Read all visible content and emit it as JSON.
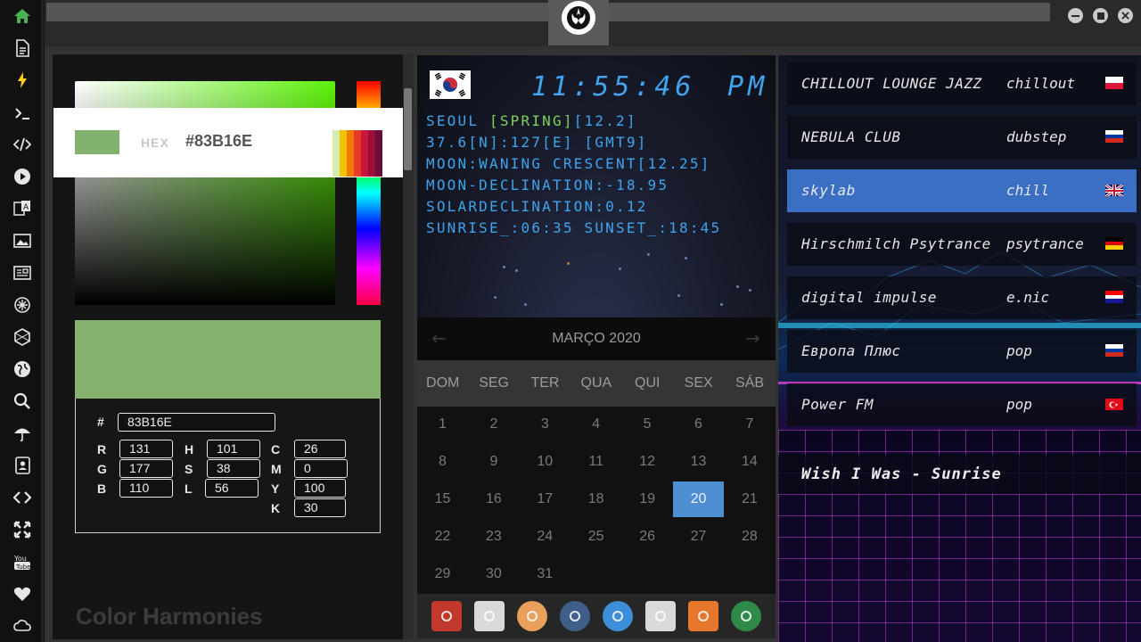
{
  "colors": {
    "selected": "#83B16E",
    "accent_blue": "#4E8FD4",
    "clock_blue": "#40A4F0",
    "station_active": "#3A6FC4"
  },
  "color_picker": {
    "hex_label": "HEX",
    "hex_value": "#83B16E",
    "hash_label": "#",
    "hex_input": "83B16E",
    "r_label": "R",
    "r_value": "131",
    "g_label": "G",
    "g_value": "177",
    "b_label": "B",
    "b_value": "110",
    "h_label": "H",
    "h_value": "101",
    "s_label": "S",
    "s_value": "38",
    "l_label": "L",
    "l_value": "56",
    "c_label": "C",
    "c_value": "26",
    "m_label": "M",
    "m_value": "0",
    "y_label": "Y",
    "y_value": "100",
    "k_label": "K",
    "k_value": "30",
    "harmonies_title": "Color Harmonies",
    "shade_colors": [
      "#d4ecaf",
      "#f2c200",
      "#f07a00",
      "#e63a2a",
      "#c8173a",
      "#9c0f3d",
      "#6b0c3a"
    ]
  },
  "clock": {
    "time": "11:55:46",
    "ampm": "PM",
    "city": "SEOUL ",
    "season": "[SPRING]",
    "season_value": "[12.2]",
    "coords": "37.6[N]:127[E] [GMT9]",
    "moon": "MOON:WANING CRESCENT[12.25]",
    "moon_declination": "MOON-DECLINATION:-18.95",
    "solar_declination": "SOLARDECLINATION:0.12",
    "sun": "SUNRISE_:06:35 SUNSET_:18:45"
  },
  "calendar": {
    "month_title": "MARÇO 2020",
    "prev": "←",
    "next": "→",
    "weekdays": [
      "DOM",
      "SEG",
      "TER",
      "QUA",
      "QUI",
      "SEX",
      "SÁB"
    ],
    "weeks": [
      [
        "1",
        "2",
        "3",
        "4",
        "5",
        "6",
        "7"
      ],
      [
        "8",
        "9",
        "10",
        "11",
        "12",
        "13",
        "14"
      ],
      [
        "15",
        "16",
        "17",
        "18",
        "19",
        "20",
        "21"
      ],
      [
        "22",
        "23",
        "24",
        "25",
        "26",
        "27",
        "28"
      ],
      [
        "29",
        "30",
        "31",
        "",
        "",
        "",
        ""
      ]
    ],
    "today": "20"
  },
  "dock": [
    {
      "icon": "app-launcher-icon",
      "color": "#c0392b"
    },
    {
      "icon": "news-icon",
      "color": "#d9d9d9"
    },
    {
      "icon": "search-icon",
      "color": "#e8a05a"
    },
    {
      "icon": "clock-icon",
      "color": "#3f5f8a"
    },
    {
      "icon": "globe-icon",
      "color": "#3d8ed8"
    },
    {
      "icon": "calendar-icon",
      "color": "#d9d9d9"
    },
    {
      "icon": "arrow-icon",
      "color": "#e8772e"
    },
    {
      "icon": "yandex-icon",
      "color": "#2f8a4a"
    }
  ],
  "radio": {
    "stations": [
      {
        "name": "CHILLOUT LOUNGE JAZZ",
        "genre": "chillout",
        "flag": "poland"
      },
      {
        "name": "NEBULA CLUB",
        "genre": "dubstep",
        "flag": "russia"
      },
      {
        "name": "skylab",
        "genre": "chill",
        "flag": "uk"
      },
      {
        "name": "Hirschmilch Psytrance",
        "genre": "psytrance",
        "flag": "germany"
      },
      {
        "name": "digital impulse",
        "genre": "e.nic",
        "flag": "croatia"
      },
      {
        "name": "Европа Плюс",
        "genre": "pop",
        "flag": "russia"
      },
      {
        "name": "Power FM",
        "genre": "pop",
        "flag": "turkey"
      }
    ],
    "now_playing": "Wish I Was - Sunrise"
  },
  "sidebar": {
    "icons": [
      "home-icon",
      "document-icon",
      "lightning-icon",
      "terminal-icon",
      "code-icon",
      "play-icon",
      "translate-icon",
      "image-icon",
      "newspaper-icon",
      "sun-icon",
      "hexagon-icon",
      "globe-icon",
      "search-icon",
      "umbrella-icon",
      "contacts-icon",
      "code-tag-icon",
      "expand-icon",
      "youtube-icon",
      "heart-icon",
      "cloud-icon"
    ]
  }
}
